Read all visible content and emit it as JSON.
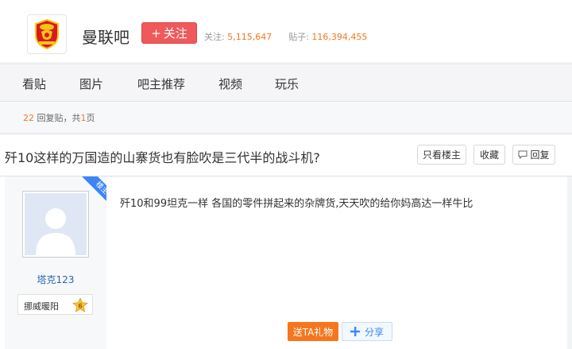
{
  "forum": {
    "name": "曼联吧",
    "follow_label": "关注",
    "followers_label": "关注:",
    "followers_count": "5,115,647",
    "posts_label": "贴子:",
    "posts_count": "116,394,455"
  },
  "nav": {
    "items": [
      "看贴",
      "图片",
      "吧主推荐",
      "视频",
      "玩乐"
    ]
  },
  "reply_info": {
    "count": "22",
    "label_mid": "回复贴，共",
    "pages": "1",
    "label_end": "页"
  },
  "thread": {
    "title": "歼10这样的万国造的山寨货也有脸吹是三代半的战斗机?",
    "buttons": {
      "only_op": "只看楼主",
      "favorite": "收藏",
      "reply": "回复"
    }
  },
  "post": {
    "badge": "楼主",
    "author": "塔克123",
    "level_name": "挪威暖阳",
    "level_num": "6",
    "content": "歼10和99坦克一样 各国的零件拼起来的杂牌货,天天吹的给你妈高达一样牛比",
    "gift_label": "送TA礼物",
    "share_label": "分享"
  },
  "colors": {
    "accent_orange": "#f5761d",
    "follow_red": "#f0595b",
    "link_blue": "#2d64b3",
    "badge_blue": "#3b85f5"
  }
}
